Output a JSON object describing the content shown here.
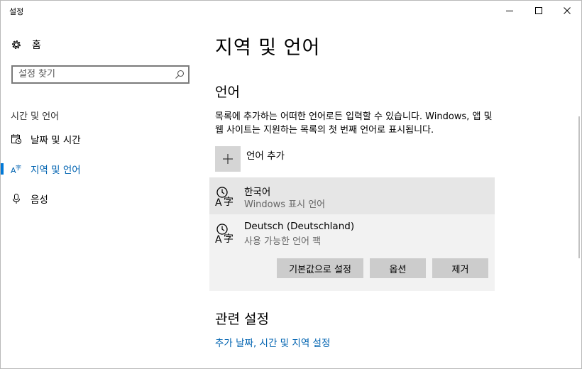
{
  "window": {
    "title": "설정"
  },
  "sidebar": {
    "home_label": "홈",
    "search_placeholder": "설정 찾기",
    "section_label": "시간 및 언어",
    "items": [
      {
        "label": "날짜 및 시간",
        "icon": "calendar-clock-icon",
        "active": false
      },
      {
        "label": "지역 및 언어",
        "icon": "region-language-icon",
        "active": true
      },
      {
        "label": "음성",
        "icon": "microphone-icon",
        "active": false
      }
    ]
  },
  "main": {
    "title": "지역 및 언어",
    "language_heading": "언어",
    "description": "목록에 추가하는 어떠한 언어로든 입력할 수 있습니다. Windows, 앱 및 웹 사이트는 지원하는 목록의 첫 번째 언어로 표시됩니다.",
    "add_language_label": "언어 추가",
    "languages": [
      {
        "name": "한국어",
        "status": "Windows 표시 언어"
      },
      {
        "name": "Deutsch (Deutschland)",
        "status": "사용 가능한 언어 팩"
      }
    ],
    "buttons": {
      "set_default": "기본값으로 설정",
      "options": "옵션",
      "remove": "제거"
    },
    "related_heading": "관련 설정",
    "related_link": "추가 날짜, 시간 및 지역 설정"
  },
  "colors": {
    "accent": "#0078d7",
    "link": "#0063b1",
    "selected_row": "#e6e6e6",
    "expanded_row": "#f2f2f2",
    "button": "#cccccc"
  }
}
